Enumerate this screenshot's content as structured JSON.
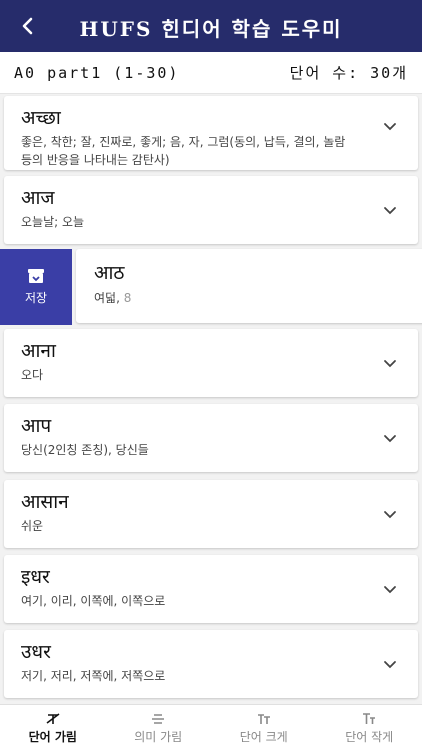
{
  "header": {
    "title": "HUFS 힌디어 학습 도우미",
    "back_icon": "back-arrow-icon"
  },
  "subbar": {
    "lesson": "A0 part1 (1-30)",
    "count_label": "단어 수: 30개"
  },
  "save_action": {
    "label": "저장",
    "icon": "archive-icon"
  },
  "words": [
    {
      "word": "अच्छा",
      "meaning": "좋은, 착한; 잘, 진짜로, 좋게; 음, 자, 그럼(동의, 납득, 결의, 놀람 등의 반응을 나타내는 감탄사)"
    },
    {
      "word": "आज",
      "meaning": "오늘날; 오늘"
    },
    {
      "word": "आठ",
      "meaning": "여덟, ",
      "meaning_extra": "8"
    },
    {
      "word": "आना",
      "meaning": "오다"
    },
    {
      "word": "आप",
      "meaning": "당신(2인칭 존칭), 당신들"
    },
    {
      "word": "आसान",
      "meaning": "쉬운"
    },
    {
      "word": "इधर",
      "meaning": "여기, 이리, 이쪽에, 이쪽으로"
    },
    {
      "word": "उधर",
      "meaning": "저기, 저리, 저쪽에, 저쪽으로"
    }
  ],
  "bottom_nav": [
    {
      "label": "단어 가림",
      "icon": "hide-word-icon",
      "active": true
    },
    {
      "label": "의미 가림",
      "icon": "hide-meaning-icon",
      "active": false
    },
    {
      "label": "단어 크게",
      "icon": "text-larger-icon",
      "active": false
    },
    {
      "label": "단어 작게",
      "icon": "text-smaller-icon",
      "active": false
    }
  ]
}
